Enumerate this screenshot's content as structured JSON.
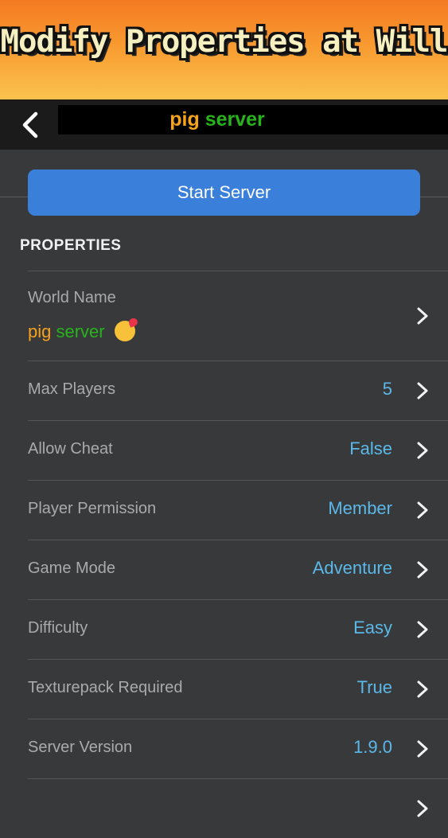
{
  "banner": {
    "title": "Modify Properties at Will"
  },
  "navbar": {
    "title_part1": "pig",
    "title_part2": "server"
  },
  "start_button": {
    "label": "Start Server"
  },
  "properties": {
    "header": "PROPERTIES",
    "world_name": {
      "label": "World Name",
      "value_part1": "pig",
      "value_part2": "server",
      "emoji": "kissing-face-icon"
    },
    "rows": [
      {
        "label": "Max Players",
        "value": "5"
      },
      {
        "label": "Allow Cheat",
        "value": "False"
      },
      {
        "label": "Player Permission",
        "value": "Member"
      },
      {
        "label": "Game Mode",
        "value": "Adventure"
      },
      {
        "label": "Difficulty",
        "value": "Easy"
      },
      {
        "label": "Texturepack Required",
        "value": "True"
      },
      {
        "label": "Server Version",
        "value": "1.9.0"
      }
    ]
  },
  "colors": {
    "banner_top": "#f47a22",
    "banner_bottom": "#fbc24d",
    "background": "#38393b",
    "button": "#3a7fda",
    "value_text": "#5bb8e8",
    "orange": "#f7a21b",
    "green": "#27b31a"
  }
}
